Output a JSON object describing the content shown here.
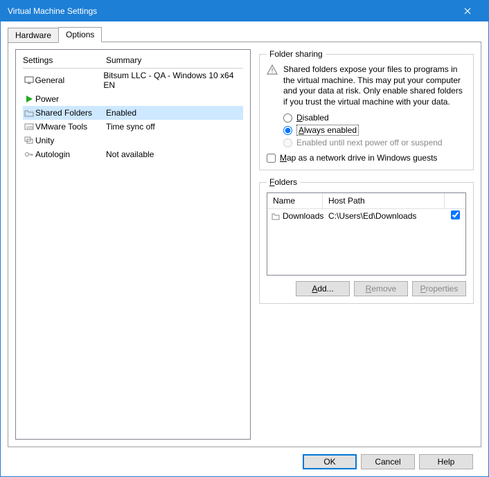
{
  "window": {
    "title": "Virtual Machine Settings"
  },
  "tabs": {
    "hardware": "Hardware",
    "options": "Options"
  },
  "columns": {
    "settings": "Settings",
    "summary": "Summary"
  },
  "settings": [
    {
      "label": "General",
      "summary": "Bitsum LLC - QA - Windows 10 x64 EN"
    },
    {
      "label": "Power",
      "summary": ""
    },
    {
      "label": "Shared Folders",
      "summary": "Enabled"
    },
    {
      "label": "VMware Tools",
      "summary": "Time sync off"
    },
    {
      "label": "Unity",
      "summary": ""
    },
    {
      "label": "Autologin",
      "summary": "Not available"
    }
  ],
  "sharing": {
    "legend": "Folder sharing",
    "warning": "Shared folders expose your files to programs in the virtual machine. This may put your computer and your data at risk. Only enable shared folders if you trust the virtual machine with your data.",
    "opt_disabled": "Disabled",
    "opt_always": "Always enabled",
    "opt_until": "Enabled until next power off or suspend",
    "map_drive": "Map as a network drive in Windows guests"
  },
  "folders": {
    "legend": "Folders",
    "col_name": "Name",
    "col_host": "Host Path",
    "rows": [
      {
        "name": "Downloads",
        "path": "C:\\Users\\Ed\\Downloads",
        "enabled": true
      }
    ],
    "add": "Add...",
    "remove": "Remove",
    "properties": "Properties"
  },
  "footer": {
    "ok": "OK",
    "cancel": "Cancel",
    "help": "Help"
  }
}
